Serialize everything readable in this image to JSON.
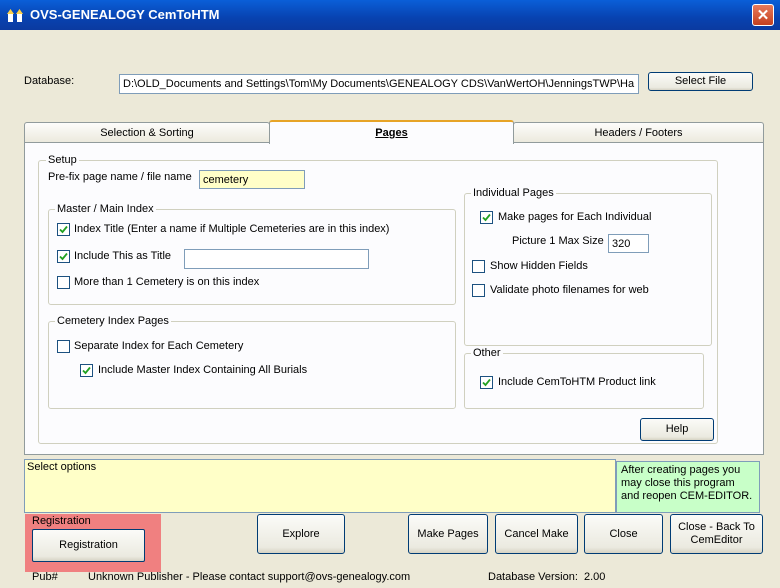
{
  "window": {
    "title": "OVS-GENEALOGY  CemToHTM",
    "close_glyph": "✕"
  },
  "database": {
    "label": "Database:",
    "path": "D:\\OLD_Documents and Settings\\Tom\\My Documents\\GENEALOGY CDS\\VanWertOH\\JenningsTWP\\Ha",
    "select_button": "Select File"
  },
  "tabs": [
    {
      "label": "Selection & Sorting",
      "active": false
    },
    {
      "label": "Pages",
      "active": true
    },
    {
      "label": "Headers / Footers",
      "active": false
    }
  ],
  "setup": {
    "group_label": "Setup",
    "prefix_label": "Pre-fix page name / file name",
    "prefix_value": "cemetery",
    "master": {
      "group_label": "Master  / Main Index",
      "index_title": {
        "label": "Index Title (Enter a name if Multiple Cemeteries are in this index)",
        "checked": true
      },
      "include_title": {
        "label": "Include This as Title",
        "checked": true,
        "value": ""
      },
      "more_than_one": {
        "label": "More than 1 Cemetery is on this index",
        "checked": false
      }
    },
    "cemetery_index": {
      "group_label": "Cemetery Index Pages",
      "separate": {
        "label": "Separate Index for Each Cemetery",
        "checked": false
      },
      "include_master": {
        "label": "Include Master Index Containing All Burials",
        "checked": true
      }
    },
    "individual": {
      "group_label": "Individual Pages",
      "make_pages": {
        "label": "Make pages for Each Individual",
        "checked": true
      },
      "picture_label": "Picture 1 Max Size",
      "picture_value": "320",
      "show_hidden": {
        "label": "Show Hidden Fields",
        "checked": false
      },
      "validate_photo": {
        "label": "Validate photo filenames for web",
        "checked": false
      }
    },
    "other": {
      "group_label": "Other",
      "product_link": {
        "label": "Include CemToHTM Product link",
        "checked": true
      }
    },
    "help_button": "Help"
  },
  "status": {
    "text": "Select options",
    "hint": "After creating pages you may close this program and reopen CEM-EDITOR."
  },
  "registration": {
    "group_label": "Registration",
    "button": "Registration"
  },
  "actions": {
    "explore": "Explore",
    "make_pages": "Make Pages",
    "cancel_make": "Cancel Make",
    "close": "Close",
    "close_back": "Close - Back To CemEditor"
  },
  "footer": {
    "pub_label": "Pub#",
    "publisher": "Unknown Publisher - Please  contact  support@ovs-genealogy.com",
    "db_version_label": "Database Version:",
    "db_version": "2.00"
  },
  "colors": {
    "titlebar": "#0842b0",
    "status_bg": "#ffffc8",
    "hint_bg": "#c8ffc8",
    "registration_highlight": "#f08080"
  }
}
